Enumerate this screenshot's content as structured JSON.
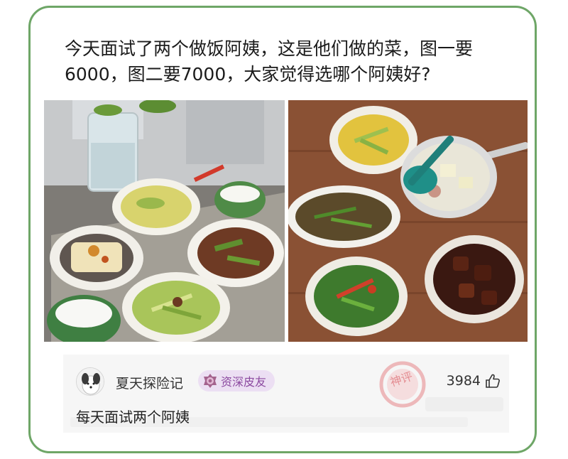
{
  "post": {
    "text": "今天面试了两个做饭阿姨，这是他们做的菜，图一要6000，图二要7000，大家觉得选哪个阿姨好?"
  },
  "photos": [
    {
      "name": "photo-1",
      "contents": [
        "water-pitcher",
        "green-egg-soup",
        "rice-bowl",
        "steamed-tofu-with-egg",
        "braised-meat-with-green-beans",
        "celery-stir-fry",
        "rice-bowl"
      ]
    },
    {
      "name": "photo-2",
      "contents": [
        "egg-stir-fry",
        "green-pepper-shredded-pork",
        "radish-soup-with-ladle",
        "pepper-stir-fry",
        "braised-pork"
      ]
    }
  ],
  "comment": {
    "username": "夏天探险记",
    "badge": "资深皮友",
    "badge_icon": "rank-badge-icon",
    "likes": "3984",
    "like_icon": "thumbs-up-icon",
    "text": "每天面试两个阿姨",
    "stamp_text": "神评"
  },
  "colors": {
    "card_border": "#6ea667",
    "badge_bg": "#ecdff3",
    "badge_text": "#8c4aa0",
    "stamp": "#e9a3a6"
  }
}
